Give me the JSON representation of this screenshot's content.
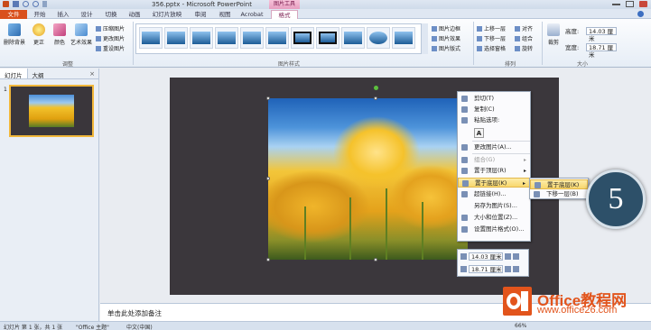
{
  "window": {
    "title": "356.pptx - Microsoft PowerPoint",
    "tools_badge": "图片工具"
  },
  "tabs": [
    "文件",
    "开始",
    "插入",
    "设计",
    "切换",
    "动画",
    "幻灯片放映",
    "审阅",
    "视图",
    "Acrobat",
    "格式"
  ],
  "ribbon": {
    "remove_bg": "删除背景",
    "correct": "更正",
    "color": "颜色",
    "art_effect": "艺术效果",
    "compress": "压缩图片",
    "change": "更改图片",
    "reset": "重设图片",
    "group_adjust": "调整",
    "group_styles": "图片样式",
    "border": "图片边框",
    "effects": "图片效果",
    "layout": "图片版式",
    "bring_forward": "上移一层",
    "send_backward": "下移一层",
    "selection_pane": "选择窗格",
    "align": "对齐",
    "group": "组合",
    "rotate": "旋转",
    "group_arrange": "排列",
    "crop": "裁剪",
    "height_label": "高度:",
    "height_value": "14.03 厘米",
    "width_label": "宽度:",
    "width_value": "18.71 厘米",
    "group_size": "大小"
  },
  "panel": {
    "tab_slides": "幻灯片",
    "tab_outline": "大纲",
    "close": "×",
    "slide_number": "1"
  },
  "context_menu": {
    "items": [
      "剪切(T)",
      "复制(C)",
      "粘贴选项:",
      "更改图片(A)...",
      "组合(G)",
      "置于顶层(R)",
      "置于底层(K)",
      "超链接(H)...",
      "另存为图片(S)...",
      "大小和位置(Z)...",
      "设置图片格式(O)..."
    ],
    "paste_glyph": "A",
    "submenu": [
      "置于底层(K)",
      "下移一层(B)"
    ]
  },
  "mini_toolbar": {
    "height_value": "14.03 厘米",
    "width_value": "18.71 厘米"
  },
  "step_badge": "5",
  "notes_placeholder": "单击此处添加备注",
  "status": {
    "slide_info": "幻灯片 第 1 张，共 1 张",
    "theme": "\"Office 主题\"",
    "language": "中文(中国)",
    "zoom": "66%"
  },
  "watermark": {
    "line1": "Office教程网",
    "line2": "www.office26.com"
  },
  "colors": {
    "file_tab": "#d9501c",
    "highlight": "#f8d76d",
    "badge": "#2d5069",
    "watermark": "#e2541c"
  }
}
